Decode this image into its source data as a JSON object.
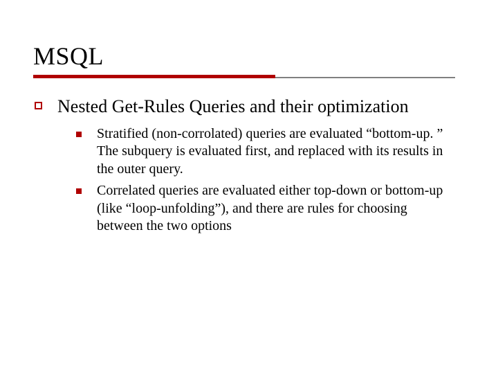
{
  "title": "MSQL",
  "heading": "Nested Get-Rules Queries and their optimization",
  "points": [
    "Stratified (non-corrolated) queries are evaluated “bottom-up. ” The subquery is evaluated first, and replaced with its results in the outer query.",
    "Correlated queries are evaluated either top-down or bottom-up (like “loop-unfolding”), and there are rules for choosing between the two options"
  ]
}
